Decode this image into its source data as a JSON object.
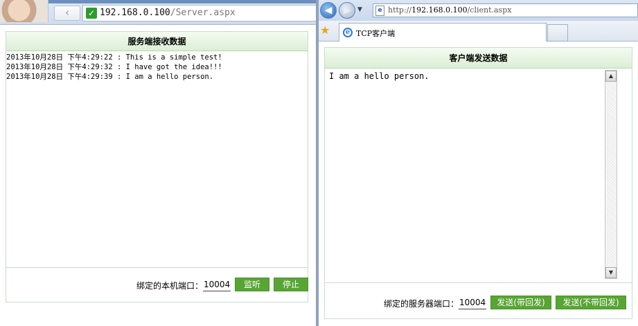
{
  "server_window": {
    "url_host": "192.168.0.100",
    "url_path": "/Server.aspx",
    "back_glyph": "‹",
    "secure_glyph": "✓",
    "panel_title": "服务端接收数据",
    "log": [
      "2013年10月28日 下午4:29:22 : This is a simple test!",
      "2013年10月28日 下午4:29:32 : I have got the idea!!!",
      "2013年10月28日 下午4:29:39 : I am a hello person."
    ],
    "port_label": "绑定的本机端口：",
    "port_value": "10004",
    "listen_button": "监听",
    "stop_button": "停止"
  },
  "client_window": {
    "url_scheme": "http://",
    "url_host": "192.168.0.100",
    "url_path": "/client.aspx",
    "tab_title": "TCP客户端",
    "panel_title": "客户端发送数据",
    "message": "I am a hello person.",
    "port_label": "绑定的服务器端口：",
    "port_value": "10004",
    "send_with_reply_button": "发送(带回发)",
    "send_without_reply_button": "发送(不带回发)"
  },
  "colors": {
    "button_green": "#58a534",
    "panel_header_green": "#dcefd6",
    "secure_green": "#2e9b31"
  },
  "icons": {
    "left_back": "back-arrow-icon",
    "secure": "secure-check-icon",
    "ie_back": "back-arrow-icon",
    "ie_forward": "forward-arrow-icon",
    "favorites": "star-icon",
    "tab_favicon": "ie-logo-icon"
  }
}
